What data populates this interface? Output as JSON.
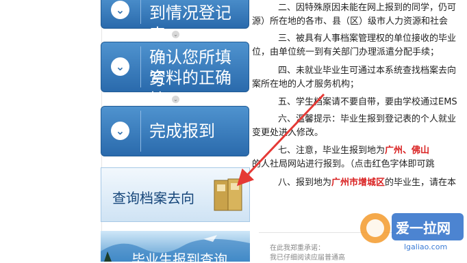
{
  "sidebar": {
    "steps": [
      {
        "label_line1": "到情况登记表"
      },
      {
        "label_line1": "确认您所填写",
        "label_line2": "资料的正确性"
      },
      {
        "label_line1": "完成报到"
      }
    ],
    "query_banner": {
      "label": "查询档案去向",
      "folder_label": "档案"
    },
    "bottom_banner": {
      "label": "毕业生报到查询"
    }
  },
  "content": {
    "p2a": "二、因特殊原因未能在网上报到的同学，仍可",
    "p2b": "源）所在地的各市、县（区）级市人力资源和社会",
    "p3a": "三、被具有人事档案管理权的单位接收的毕业",
    "p3b": "位，由单位统一到有关部门办理派遣分配手续；",
    "p4a": "四、未就业毕业生可通过本系统查找档案去向",
    "p4b": "案所在地的人才服务机构；",
    "p5a": "五、学生档案请不要自带，要由学校通过EMS",
    "p6a": "六、温馨提示：毕业生报到登记表的个人就业",
    "p6b": "变更处进入修改。",
    "p7a_pre": "七、注意，毕业生报到地为",
    "p7a_city1": "广州",
    "p7a_sep": "、",
    "p7a_city2": "佛山",
    "p7b": "的人社局网站进行报到。（点击红色字体即可跳",
    "p8a_pre": "八、报到地为",
    "p8a_district": "广州市增城区",
    "p8a_post": "的毕业生，请在本"
  },
  "pledge": {
    "line1": "在此我郑重承诺：",
    "line2": "我已仔细阅读应届普通高"
  },
  "watermark": {
    "brand": "爱一拉网",
    "url": "lgaliao.com"
  },
  "colors": {
    "button_blue": "#3a7cbf",
    "annotation_red": "#e53935",
    "highlight_red": "#d92020"
  }
}
